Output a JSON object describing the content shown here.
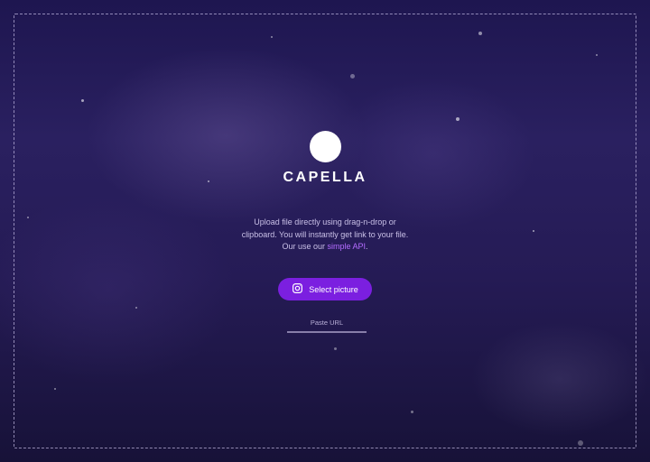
{
  "brand": {
    "name": "CAPELLA"
  },
  "upload": {
    "line1": "Upload file directly using drag-n-drop or",
    "line2": "clipboard. You will instantly get link to your file.",
    "line3_prefix": "Our use our ",
    "api_link": "simple API",
    "line3_suffix": "."
  },
  "select_button": {
    "label": "Select picture",
    "icon": "instagram-icon"
  },
  "paste": {
    "label": "Paste URL"
  },
  "colors": {
    "accent": "#7b1fe0",
    "link": "#b36cff",
    "background": "#1e1650"
  }
}
